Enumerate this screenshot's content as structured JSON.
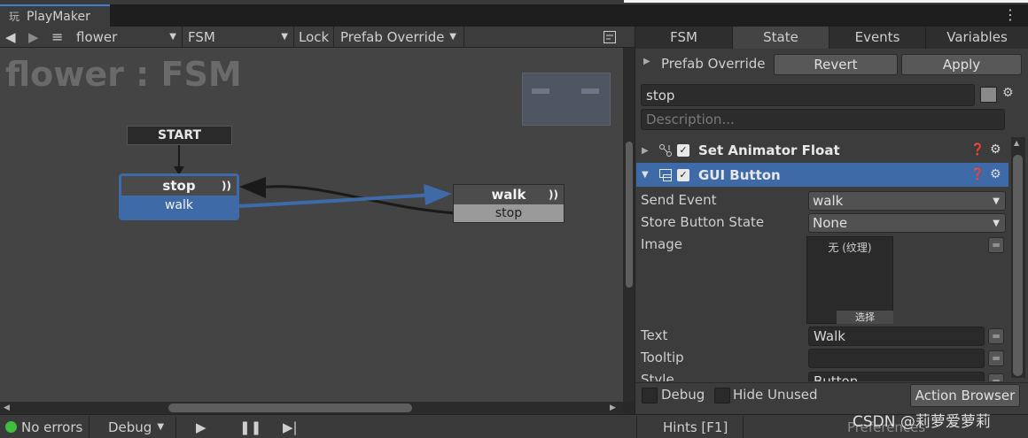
{
  "window": {
    "tab_title": "PlayMaker"
  },
  "toolbar": {
    "object_name": "flower",
    "fsm_name": "FSM",
    "lock_label": "Lock",
    "prefab_label": "Prefab Override"
  },
  "canvas": {
    "title": "flower : FSM",
    "start_label": "START",
    "state_stop": {
      "name": "stop",
      "transition": "walk"
    },
    "state_walk": {
      "name": "walk",
      "transition": "stop"
    }
  },
  "panel": {
    "tabs": [
      "FSM",
      "State",
      "Events",
      "Variables"
    ],
    "active_tab": "State",
    "prefab_override_label": "Prefab Override",
    "revert_label": "Revert",
    "apply_label": "Apply",
    "state_name": "stop",
    "description_placeholder": "Description...",
    "actions": [
      {
        "name": "Set Animator Float",
        "enabled": true,
        "expanded": false
      },
      {
        "name": "GUI Button",
        "enabled": true,
        "expanded": true
      }
    ],
    "fields": {
      "send_event_label": "Send Event",
      "send_event_value": "walk",
      "store_button_state_label": "Store Button State",
      "store_button_state_value": "None",
      "image_label": "Image",
      "image_none": "无 (纹理)",
      "image_select": "选择",
      "text_label": "Text",
      "text_value": "Walk",
      "tooltip_label": "Tooltip",
      "tooltip_value": "",
      "style_label": "Style",
      "style_value": "Button"
    },
    "footer": {
      "debug_label": "Debug",
      "hide_unused_label": "Hide Unused",
      "action_browser_label": "Action Browser"
    }
  },
  "statusbar": {
    "errors": "No errors",
    "debug": "Debug",
    "hints": "Hints [F1]",
    "preferences": "Preferences"
  },
  "watermark": "CSDN @莉萝爱萝莉",
  "colors": {
    "accent": "#3e6aa8",
    "ok": "#3fbf3f",
    "selected_header": "#3e6aa8"
  }
}
